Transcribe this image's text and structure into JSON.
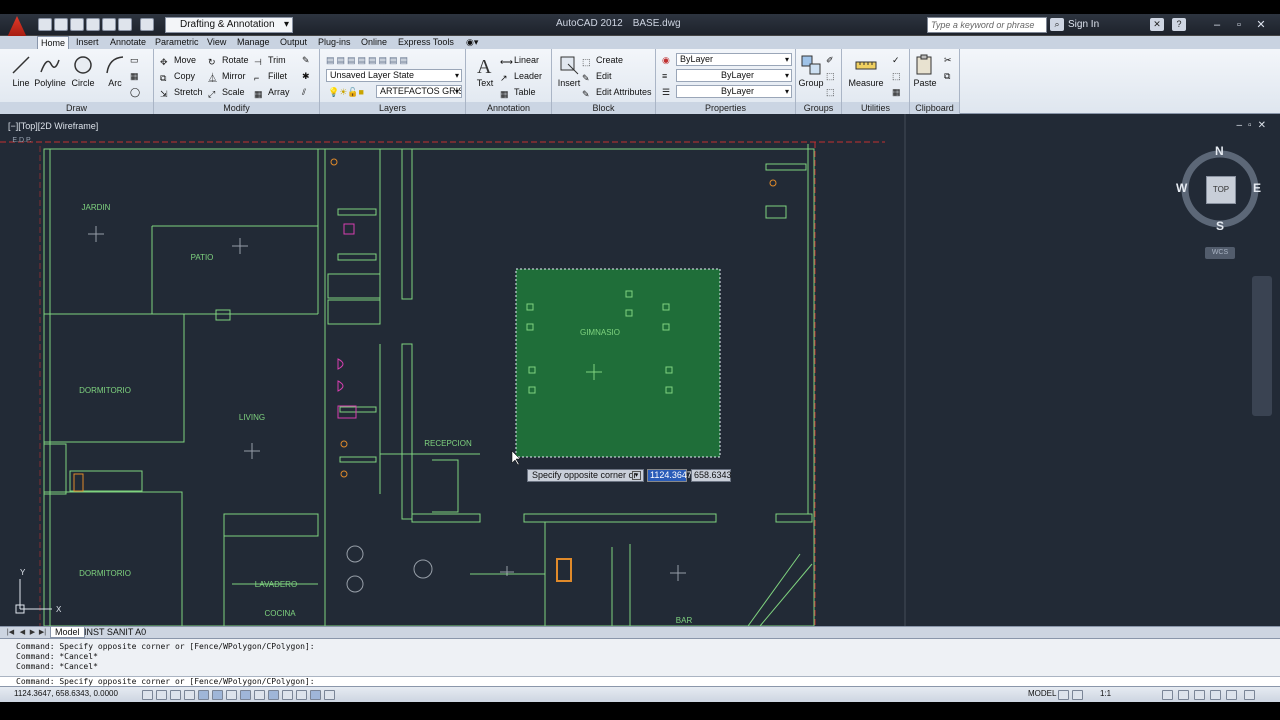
{
  "titlebar": {
    "workspace": "Drafting & Annotation",
    "app_name": "AutoCAD 2012",
    "file_name": "BASE.dwg",
    "search_placeholder": "Type a keyword or phrase",
    "signin": "Sign In"
  },
  "ribbon": {
    "tabs": [
      "Home",
      "Insert",
      "Annotate",
      "Parametric",
      "View",
      "Manage",
      "Output",
      "Plug-ins",
      "Online",
      "Express Tools"
    ],
    "active_tab": "Home",
    "draw": {
      "title": "Draw",
      "line": "Line",
      "polyline": "Polyline",
      "circle": "Circle",
      "arc": "Arc"
    },
    "modify": {
      "title": "Modify",
      "move": "Move",
      "rotate": "Rotate",
      "trim": "Trim",
      "copy": "Copy",
      "mirror": "Mirror",
      "fillet": "Fillet",
      "stretch": "Stretch",
      "scale": "Scale",
      "array": "Array"
    },
    "layers": {
      "title": "Layers",
      "layer_state": "Unsaved Layer State",
      "current_layer": "ARTEFACTOS GRIS"
    },
    "annotation": {
      "title": "Annotation",
      "text": "Text",
      "linear": "Linear",
      "leader": "Leader",
      "table": "Table"
    },
    "block": {
      "title": "Block",
      "insert": "Insert",
      "create": "Create",
      "edit": "Edit",
      "edit_attributes": "Edit Attributes"
    },
    "properties": {
      "title": "Properties",
      "color": "ByLayer",
      "linetype": "ByLayer",
      "lineweight": "ByLayer"
    },
    "groups": {
      "title": "Groups",
      "group": "Group"
    },
    "utilities": {
      "title": "Utilities",
      "measure": "Measure"
    },
    "clipboard": {
      "title": "Clipboard",
      "paste": "Paste"
    }
  },
  "viewport": {
    "label": "[−][Top][2D Wireframe]",
    "viewcube": {
      "n": "N",
      "s": "S",
      "e": "E",
      "w": "W",
      "top": "TOP",
      "wcs": "WCS"
    },
    "ucs": {
      "y": "Y",
      "x": "X"
    },
    "edp": "E.D.P.",
    "rooms": [
      {
        "name": "JARDIN"
      },
      {
        "name": "PATIO"
      },
      {
        "name": "DORMITORIO"
      },
      {
        "name": "LIVING"
      },
      {
        "name": "DORMITORIO"
      },
      {
        "name": "LAVADERO"
      },
      {
        "name": "COCINA"
      },
      {
        "name": "GIMNASIO"
      },
      {
        "name": "RECEPCION"
      },
      {
        "name": "BAR"
      }
    ]
  },
  "dynamic_input": {
    "prompt": "Specify opposite corner or",
    "x_value": "1124.3647",
    "y_value": "658.6343"
  },
  "layout_tabs": {
    "model": "Model",
    "layout": "INST SANIT A0"
  },
  "command": {
    "history": [
      "Command: Specify opposite corner or [Fence/WPolygon/CPolygon]:",
      "Command: *Cancel*",
      "Command: *Cancel*"
    ],
    "current": "Command: Specify opposite corner or [Fence/WPolygon/CPolygon]:"
  },
  "statusbar": {
    "coordinates": "1124.3647, 658.6343, 0.0000",
    "space": "MODEL",
    "annotation_scale": "1:1"
  },
  "colors": {
    "canvas": "#222a36",
    "wall": "#7fd37f",
    "selection": "#1e7a3a",
    "red_line": "#c23030"
  }
}
